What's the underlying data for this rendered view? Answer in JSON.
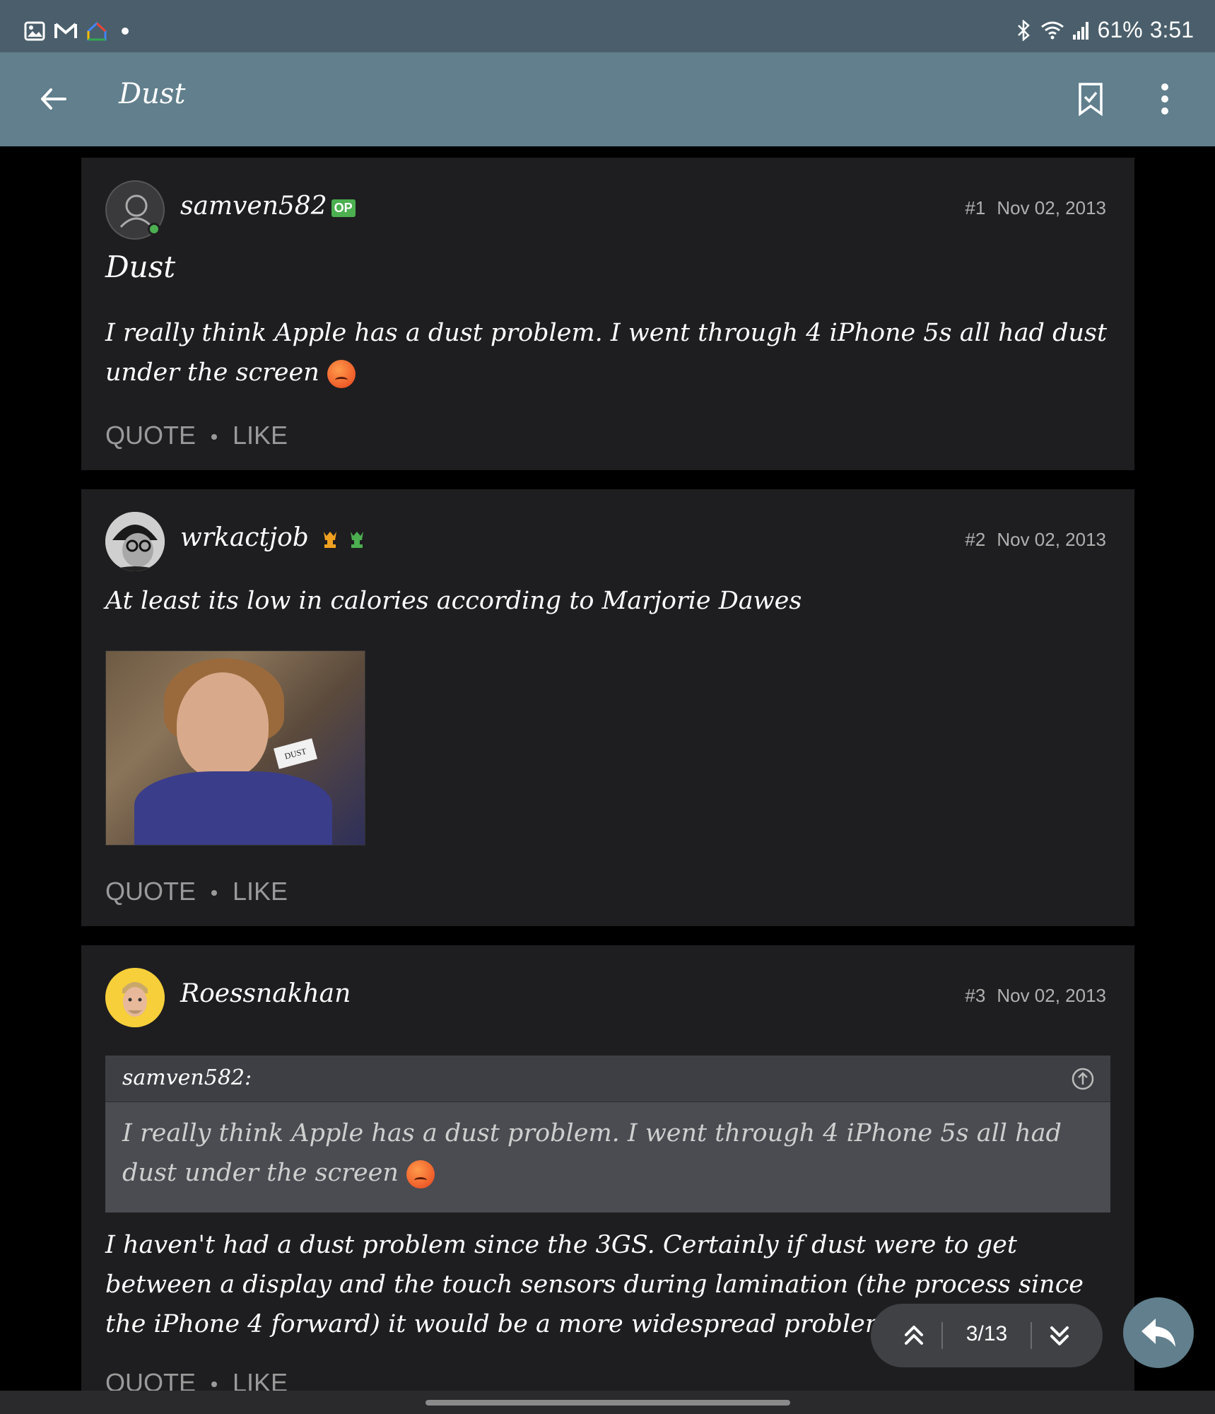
{
  "status_bar": {
    "battery": "61%",
    "time": "3:51",
    "icons_left": [
      "gallery-icon",
      "gmail-icon",
      "google-home-icon",
      "notification-dot"
    ],
    "icons_right": [
      "bluetooth-icon",
      "wifi-icon",
      "signal-icon"
    ]
  },
  "app_bar": {
    "title": "Dust",
    "icons": [
      "back-arrow-icon",
      "bookmark-icon",
      "more-vert-icon"
    ]
  },
  "posts": [
    {
      "username": "samven582",
      "badge": "OP",
      "number": "#1",
      "date": "Nov 02, 2013",
      "title": "Dust",
      "body": "I really think Apple has a dust problem. I went through 4 iPhone 5s all had dust under the screen",
      "actions": {
        "quote": "QUOTE",
        "like": "LIKE"
      }
    },
    {
      "username": "wrkactjob",
      "number": "#2",
      "date": "Nov 02, 2013",
      "body": "At least its low in calories according to Marjorie Dawes",
      "image_label": "DUST",
      "actions": {
        "quote": "QUOTE",
        "like": "LIKE"
      }
    },
    {
      "username": "Roessnakhan",
      "number": "#3",
      "date": "Nov 02, 2013",
      "quote": {
        "author": "samven582:",
        "text": "I really think Apple has a dust problem. I went through 4 iPhone 5s all had dust under the screen"
      },
      "body": "I haven't had a dust problem since the 3GS. Certainly if dust were to get between a display and the touch sensors during lamination (the process since the iPhone 4 forward) it would be a more widespread problem?",
      "actions": {
        "quote": "QUOTE",
        "like": "LIKE"
      }
    }
  ],
  "pager": {
    "count": "3/13"
  },
  "colors": {
    "status_bar": "#4a5f6b",
    "app_bar": "#617f8d",
    "post_bg": "#1e1e20",
    "online": "#4caf50",
    "op_badge": "#4caf50"
  }
}
